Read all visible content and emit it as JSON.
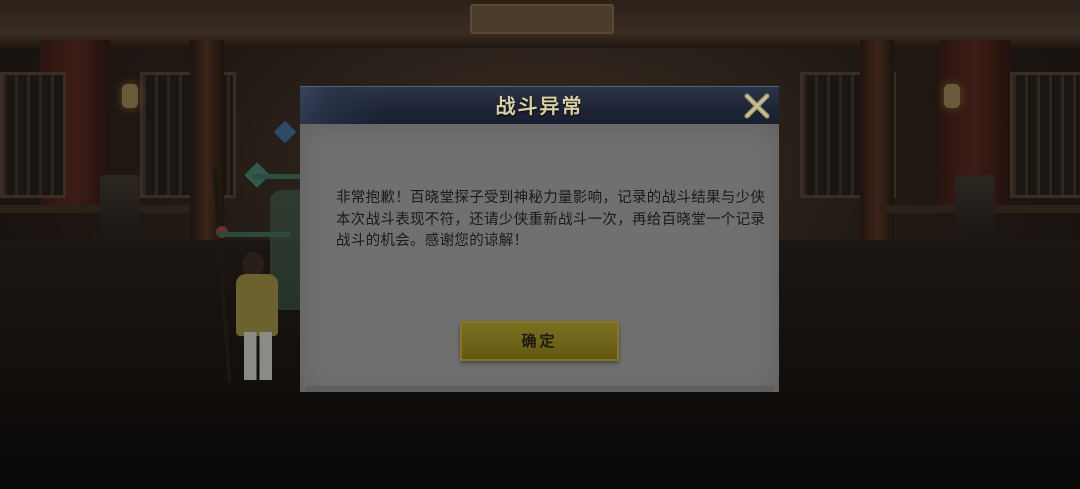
{
  "dialog": {
    "title": "战斗异常",
    "message": "非常抱歉！百晓堂探子受到神秘力量影响，记录的战斗结果与少侠本次战斗表现不符，还请少侠重新战斗一次，再给百晓堂一个记录战斗的机会。感谢您的谅解！",
    "confirm_label": "确定",
    "close_icon": "close-icon"
  },
  "colors": {
    "header_bg": "#1d2535",
    "title_text": "#d9cfa4",
    "body_bg": "#707070",
    "confirm_button": "#6e6318",
    "overlay": "rgba(0,0,0,0.55)"
  }
}
